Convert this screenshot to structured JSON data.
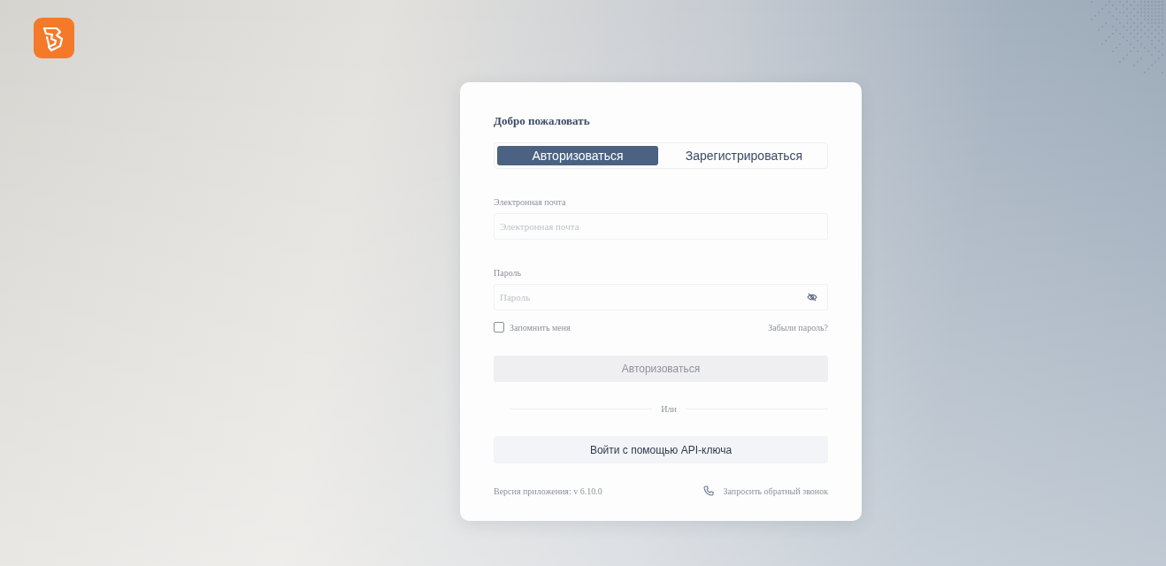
{
  "login_card": {
    "title": "Добро пожаловать",
    "tabs": [
      {
        "label": "Авторизоваться",
        "selected": true
      },
      {
        "label": "Зарегистрироваться",
        "selected": false
      }
    ],
    "fields": [
      {
        "kind": "text",
        "label": "Электронная почта",
        "placeholder": "Электронная почта"
      },
      {
        "kind": "password",
        "label": "Пароль",
        "placeholder": "Пароль"
      }
    ],
    "remember": {
      "label": "Запомнить меня",
      "checked": false
    },
    "forgot_link": "Забыли пароль?",
    "submit": {
      "label": "Авторизоваться",
      "disabled": true
    },
    "divider": "Или",
    "api_button": "Войти с помощью API-ключа",
    "version": "Версия приложения: v 6.10.0",
    "callback_link": "Запросить обратный звонок"
  }
}
